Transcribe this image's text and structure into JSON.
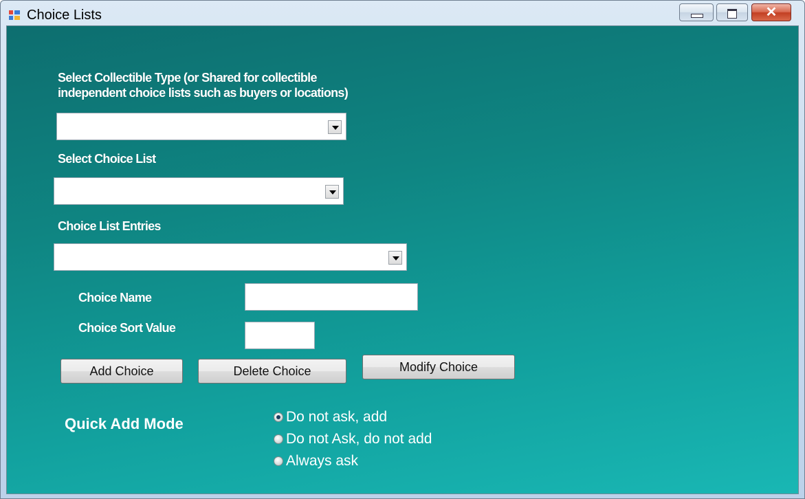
{
  "window": {
    "title": "Choice Lists"
  },
  "titlebar_buttons": {
    "minimize": "minimize-icon",
    "maximize": "maximize-icon",
    "close": "close-icon"
  },
  "form": {
    "collectible_type_label_line1": "Select Collectible Type (or Shared for collectible",
    "collectible_type_label_line2": "independent choice lists such as buyers or locations)",
    "collectible_type_value": "",
    "choice_list_label": "Select Choice List",
    "choice_list_value": "",
    "entries_label": "Choice List Entries",
    "entries_value": "",
    "choice_name_label": "Choice Name",
    "choice_name_value": "",
    "sort_value_label": "Choice Sort Value",
    "sort_value_value": ""
  },
  "buttons": {
    "add": "Add Choice",
    "delete": "Delete Choice",
    "modify": "Modify Choice"
  },
  "quick_add": {
    "label": "Quick Add Mode",
    "options": [
      {
        "label": "Do not ask, add",
        "checked": true
      },
      {
        "label": "Do not Ask, do not add",
        "checked": false
      },
      {
        "label": "Always ask",
        "checked": false
      }
    ]
  }
}
